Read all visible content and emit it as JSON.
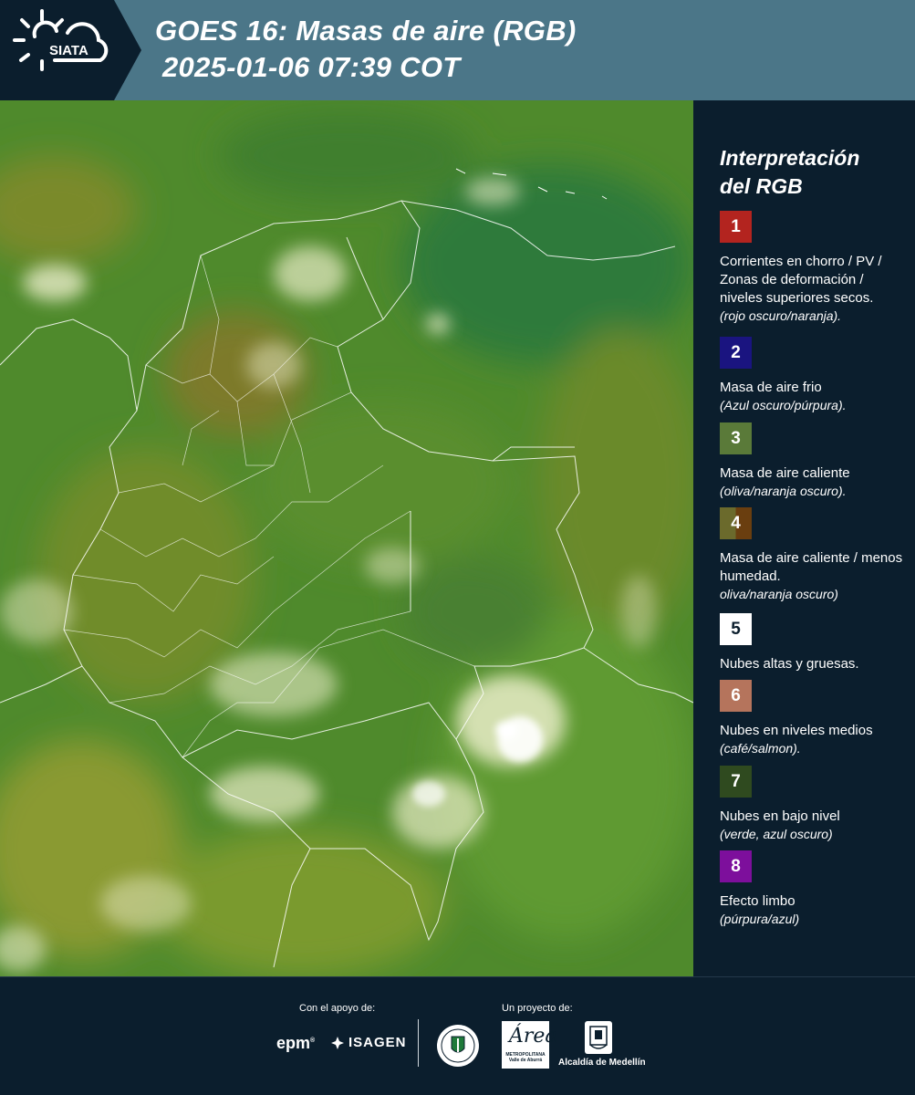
{
  "header": {
    "logo_text": "SIATA",
    "title_line1": "GOES 16: Masas de aire (RGB)",
    "title_line2": "2025-01-06 07:39 COT"
  },
  "legend": {
    "title_line1": "Interpretación",
    "title_line2": "del RGB",
    "items": [
      {
        "number": "1",
        "color": "#b3241f",
        "text": "Corrientes en chorro / PV / Zonas de deformación / niveles superiores secos.",
        "note": "(rojo oscuro/naranja)."
      },
      {
        "number": "2",
        "color": "#1a1480",
        "text": "Masa de aire frio",
        "note": "(Azul oscuro/púrpura)."
      },
      {
        "number": "3",
        "color": "#5a7a39",
        "text": "Masa de aire caliente",
        "note": "(oliva/naranja oscuro)."
      },
      {
        "number": "4",
        "color_a": "#6b6a2c",
        "color_b": "#6a3e0f",
        "text": "Masa de aire caliente / menos humedad.",
        "note": "oliva/naranja oscuro)"
      },
      {
        "number": "5",
        "color": "#ffffff",
        "text": "Nubes altas y gruesas.",
        "note": ""
      },
      {
        "number": "6",
        "color": "#b5745c",
        "text": "Nubes en niveles medios",
        "note": "(café/salmon)."
      },
      {
        "number": "7",
        "color": "#2f4a1f",
        "text": "Nubes en bajo nivel",
        "note": "(verde, azul oscuro)"
      },
      {
        "number": "8",
        "color": "#7d0f9c",
        "text": "Efecto limbo",
        "note": "(púrpura/azul)"
      }
    ]
  },
  "footer": {
    "support_label": "Con el apoyo de:",
    "project_label": "Un proyecto de:",
    "sponsor1": "epm",
    "sponsor2": "ISAGEN",
    "partner_metro_script": "Área",
    "partner_metro_name": "METROPOLITANA Valle de Aburrá",
    "partner_alcaldia": "Alcaldía de Medellín"
  },
  "map": {
    "base_color": "#4f8a2c",
    "cloud_color": "#f0f2d8",
    "border_color": "#ffffff"
  }
}
